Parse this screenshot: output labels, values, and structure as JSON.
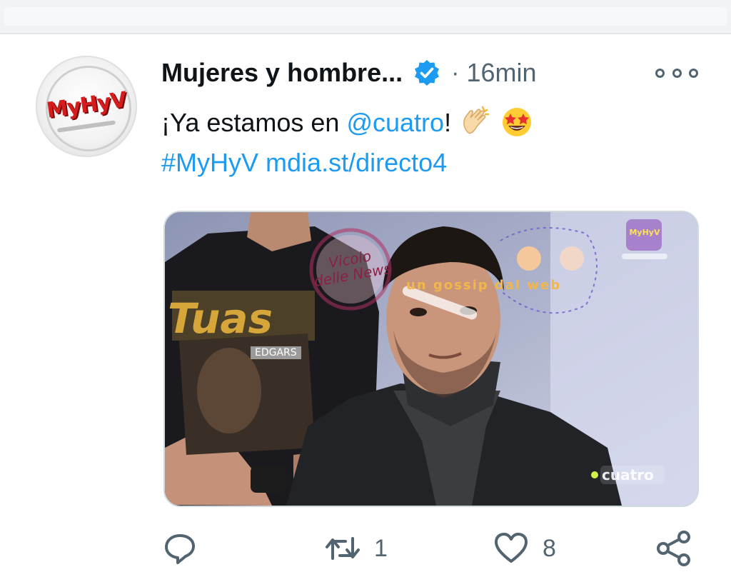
{
  "tweet": {
    "author_name": "Mujeres y hombre...",
    "time_sep": "·",
    "time": "16min",
    "text_pre": "¡Ya estamos en ",
    "mention": "@cuatro",
    "text_post": "! ",
    "hashtag": "#MyHyV",
    "url": "mdia.st/directo4",
    "avatar_brand": "MyHyV",
    "emoji": [
      "clapping-hands",
      "star-struck-face"
    ]
  },
  "media": {
    "shirt_text": "Tuas",
    "shirt_tag": "EDGARS",
    "watermark_1": "Vicolo delle News",
    "watermark_2": "un gossip dal web",
    "channel_logo": "cuatro",
    "program_badge": "MyHyV"
  },
  "actions": {
    "reply_icon": "reply-icon",
    "retweet_icon": "retweet-icon",
    "retweet_count": "1",
    "like_icon": "heart-icon",
    "like_count": "8",
    "share_icon": "share-icon"
  },
  "colors": {
    "link": "#1d9bf0",
    "verified": "#1d9bf0",
    "secondary_text": "#536471",
    "brand_red": "#d61d1d"
  }
}
